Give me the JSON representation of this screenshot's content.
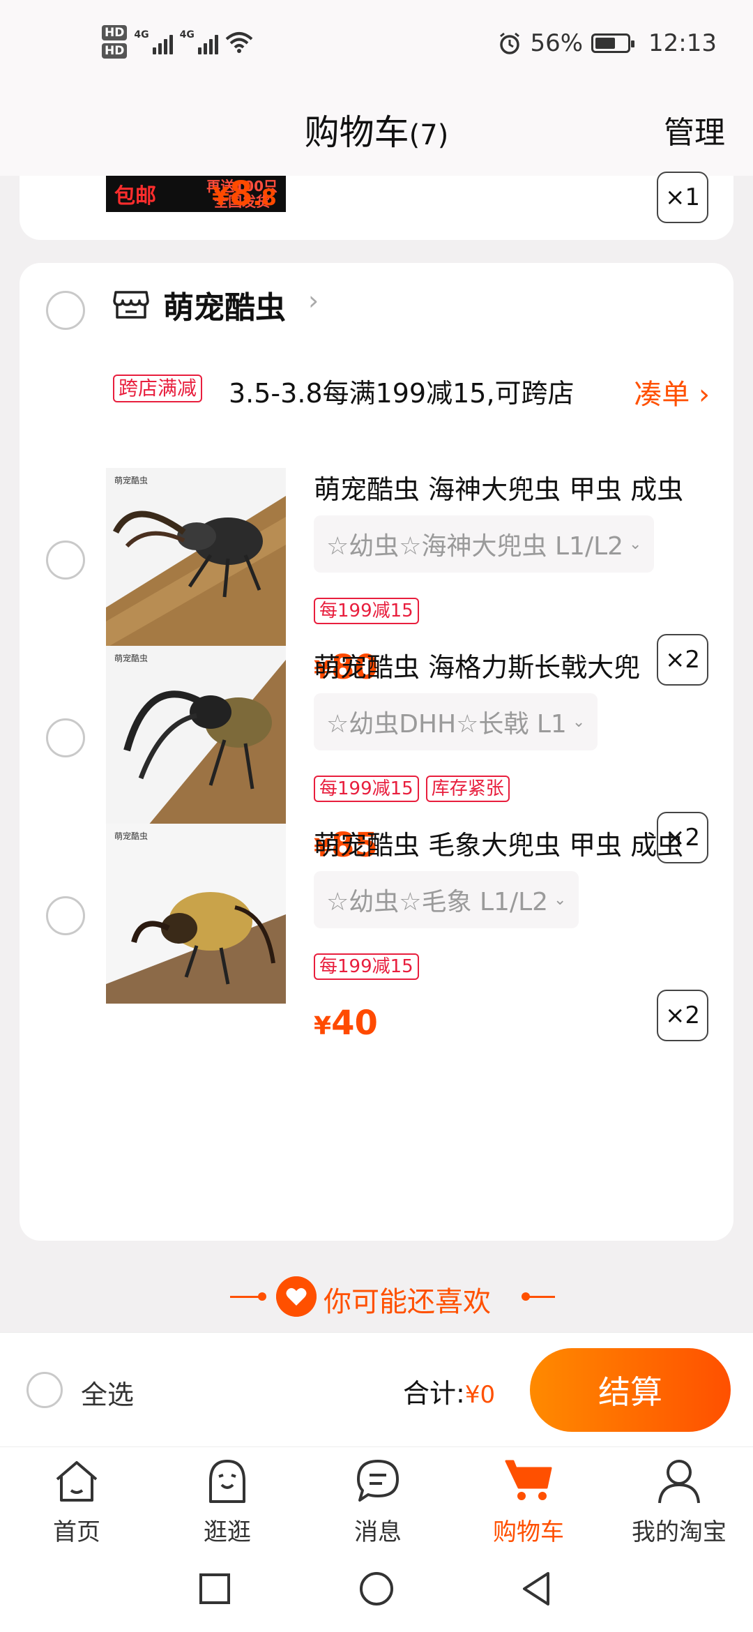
{
  "status_bar": {
    "hd1": "HD",
    "hd2": "HD",
    "net1": "4G",
    "net2": "4G",
    "battery_percent": "56%",
    "time": "12:13"
  },
  "header": {
    "title": "购物车",
    "count": "(7)",
    "manage": "管理"
  },
  "top_item": {
    "promo_left": "包邮",
    "promo_right_line1": "再送100只",
    "promo_right_line2": "全国发货",
    "price_currency": "¥",
    "price_int": "8",
    "price_dec": ".8",
    "qty": "×1"
  },
  "shop": {
    "name": "萌宠酷虫",
    "discount_tag": "跨店满减",
    "discount_text": "3.5-3.8每满199减15,可跨店",
    "discount_link": "凑单"
  },
  "items": [
    {
      "title": "萌宠酷虫 海神大兜虫 甲虫  成虫",
      "sku": "☆幼虫☆海神大兜虫 L1/L2",
      "tags": [
        "每199减15"
      ],
      "currency": "¥",
      "price": "80",
      "qty": "×2"
    },
    {
      "title": "萌宠酷虫 海格力斯长戟大兜",
      "sku": "☆幼虫DHH☆长戟 L1",
      "tags": [
        "每199减15",
        "库存紧张"
      ],
      "currency": "¥",
      "price": "85",
      "qty": "×2"
    },
    {
      "title": "萌宠酷虫 毛象大兜虫 甲虫  成虫",
      "sku": "☆幼虫☆毛象 L1/L2",
      "tags": [
        "每199减15"
      ],
      "currency": "¥",
      "price": "40",
      "qty": "×2"
    }
  ],
  "recommend": {
    "label": "你可能还喜欢"
  },
  "checkout": {
    "select_all": "全选",
    "total_label": "合计:",
    "total_amount": "¥0",
    "button": "结算"
  },
  "tabs": [
    {
      "label": "首页",
      "icon": "home-icon"
    },
    {
      "label": "逛逛",
      "icon": "discover-icon"
    },
    {
      "label": "消息",
      "icon": "message-icon"
    },
    {
      "label": "购物车",
      "icon": "cart-icon"
    },
    {
      "label": "我的淘宝",
      "icon": "profile-icon"
    }
  ],
  "colors": {
    "accent": "#ff5000",
    "tag_red": "#e81e3d",
    "background": "#f2f0f1"
  }
}
